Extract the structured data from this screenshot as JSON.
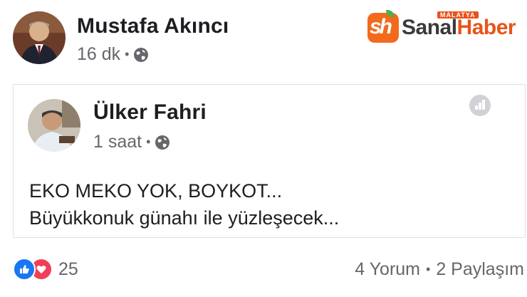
{
  "post": {
    "author": "Mustafa Akıncı",
    "time": "16 dk",
    "separator": "•",
    "audience_icon": "globe-icon"
  },
  "watermark": {
    "badge": "sh",
    "brand_part1": "Sanal",
    "brand_part2": "Haber",
    "region": "MALATYA",
    "brand_color": "#e8531a"
  },
  "shared_post": {
    "author": "Ülker Fahri",
    "time": "1 saat",
    "separator": "•",
    "audience_icon": "globe-icon",
    "text_line1": "EKO MEKO YOK, BOYKOT...",
    "text_line2": "Büyükkonuk günahı ile yüzleşecek..."
  },
  "footer": {
    "reaction_icons": [
      "like-icon",
      "love-icon"
    ],
    "reaction_count": "25",
    "comments": "4 Yorum",
    "separator": "•",
    "shares": "2 Paylaşım"
  },
  "colors": {
    "like": "#1877f2",
    "love": "#f33e58",
    "meta_text": "#65676b"
  }
}
